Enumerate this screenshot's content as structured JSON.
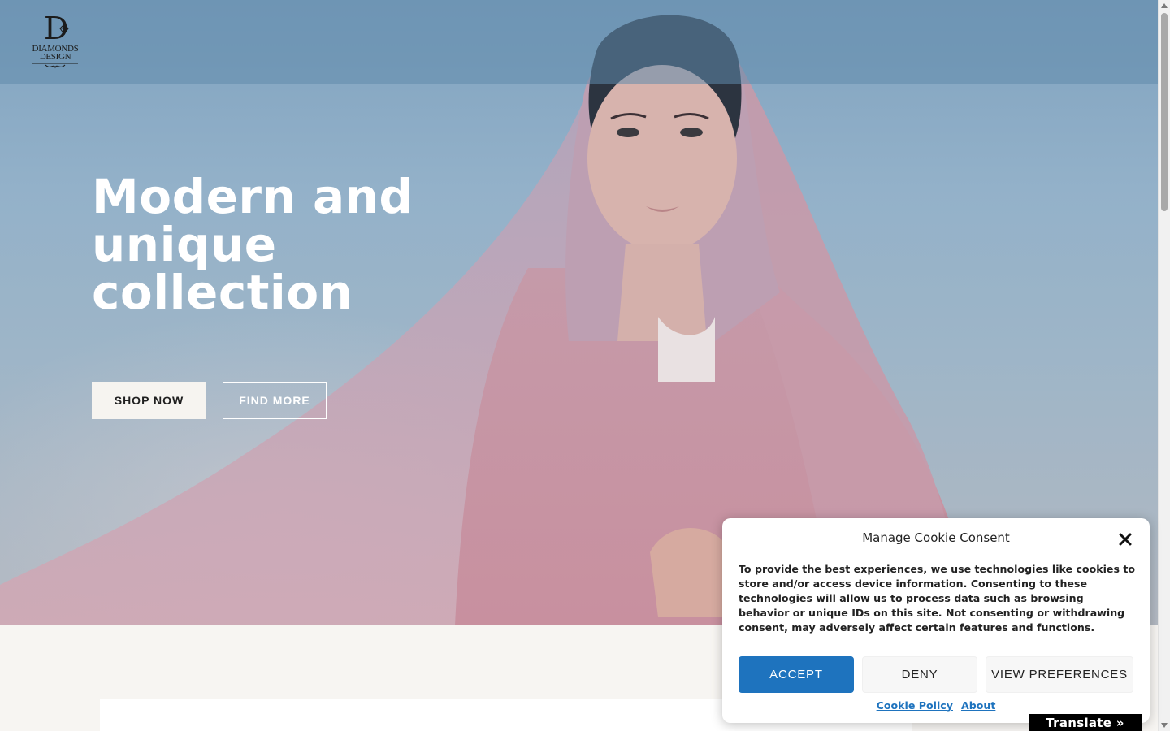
{
  "brand": {
    "monogram": "D",
    "line1": "DIAMONDS",
    "line2": "DESIGN"
  },
  "hero": {
    "headline": "Modern and unique collection",
    "primary_button": "SHOP NOW",
    "secondary_button": "FIND MORE"
  },
  "cookie_banner": {
    "title": "Manage Cookie Consent",
    "body": "To provide the best experiences, we use technologies like cookies to store and/or access device information. Consenting to these technologies will allow us to process data such as browsing behavior or unique IDs on this site. Not consenting or withdrawing consent, may adversely affect certain features and functions.",
    "accept_label": "ACCEPT",
    "deny_label": "DENY",
    "preferences_label": "VIEW PREFERENCES",
    "links": [
      "Cookie Policy",
      "About"
    ],
    "close_icon": "close-icon",
    "accent_color": "#1e73be"
  },
  "translate_widget": {
    "label": "Translate »"
  }
}
